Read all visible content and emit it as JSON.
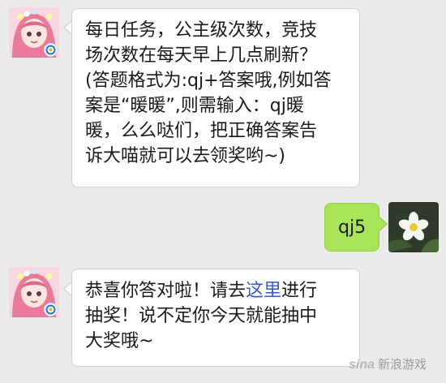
{
  "messages": [
    {
      "sender": "game-account",
      "lines": [
        "每日任务，公主级次数，竞技",
        "场次数在每天早上几点刷新？",
        "(答题格式为:qj+答案哦,例如答",
        "案是“暖暖”,则需输入：qj暖",
        "暖，么么哒们，把正确答案告",
        "诉大喵就可以去领奖哟~)"
      ]
    },
    {
      "sender": "me",
      "text": "qj5"
    },
    {
      "sender": "game-account",
      "line1_before": "恭喜你答对啦！请去",
      "line1_link": "这里",
      "line1_after": "进行",
      "line2": "抽奖！说不定你今天就能抽中",
      "line3": "大奖哦~"
    }
  ],
  "watermark": "新浪游戏",
  "colors": {
    "background": "#ebebeb",
    "incoming_bubble": "#ffffff",
    "outgoing_bubble": "#a8e45a",
    "link": "#3a59c6"
  },
  "icons": {
    "incoming_avatar": "anime-girl-avatar",
    "outgoing_avatar": "white-flower-avatar",
    "game_logo": "tencent-game-logo"
  }
}
